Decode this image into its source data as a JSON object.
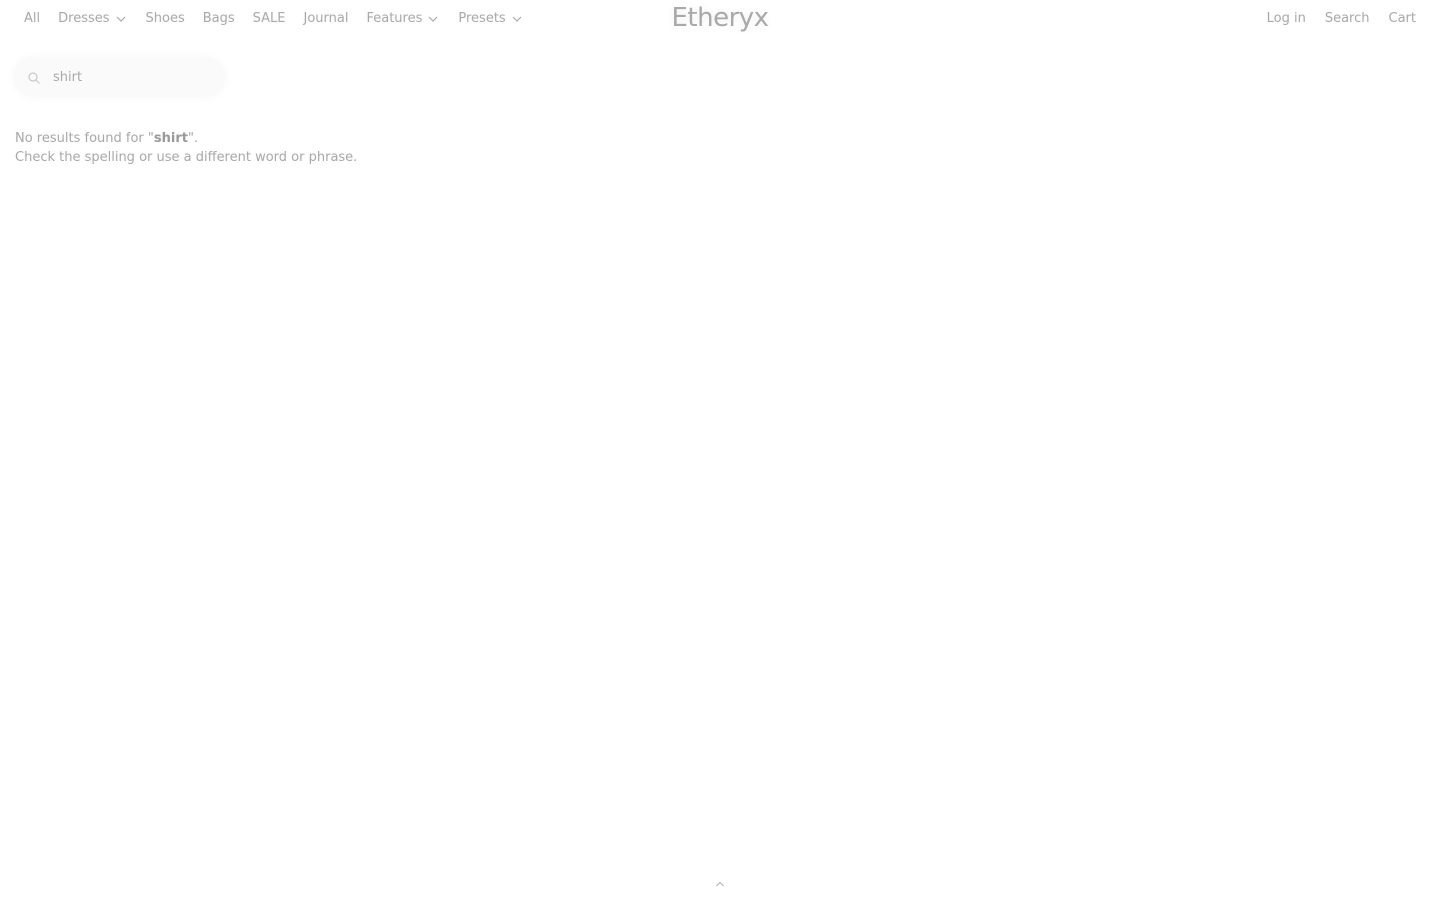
{
  "header": {
    "nav_left": [
      {
        "label": "All",
        "has_dropdown": false
      },
      {
        "label": "Dresses",
        "has_dropdown": true
      },
      {
        "label": "Shoes",
        "has_dropdown": false
      },
      {
        "label": "Bags",
        "has_dropdown": false
      },
      {
        "label": "SALE",
        "has_dropdown": false
      },
      {
        "label": "Journal",
        "has_dropdown": false
      },
      {
        "label": "Features",
        "has_dropdown": true
      },
      {
        "label": "Presets",
        "has_dropdown": true
      }
    ],
    "logo": "Etheryx",
    "nav_right": [
      {
        "label": "Log in"
      },
      {
        "label": "Search"
      },
      {
        "label": "Cart"
      }
    ]
  },
  "search": {
    "value": "shirt"
  },
  "results": {
    "prefix": "No results found for \"",
    "query": "shirt",
    "suffix": "\".",
    "hint": "Check the spelling or use a different word or phrase."
  },
  "icons": {
    "search": "search-icon",
    "dropdown": "chevron-down-icon",
    "scroll_top": "chevron-up-icon"
  },
  "colors": {
    "text": "#a9a9a9",
    "background": "#ffffff"
  }
}
